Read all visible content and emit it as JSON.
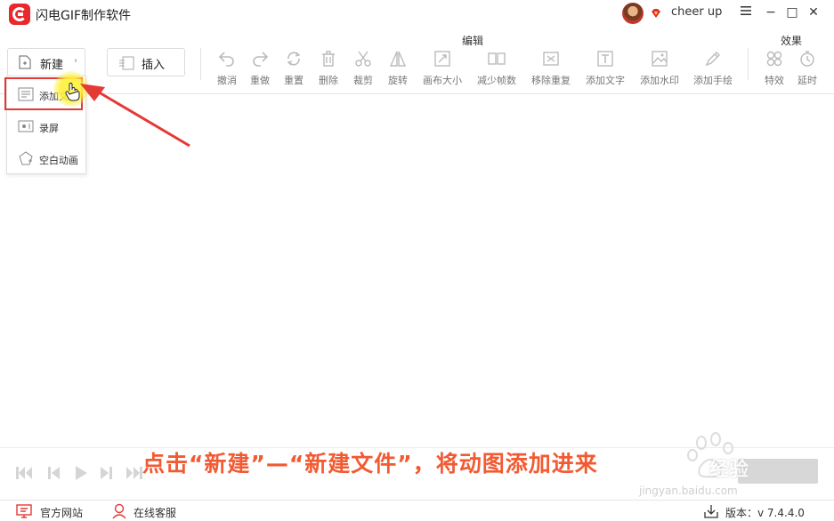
{
  "app": {
    "title": "闪电GIF制作软件",
    "user_name": "cheer up",
    "window_controls": {
      "minimize": "−",
      "maximize": "□",
      "close": "✕"
    },
    "accent": "#e8282d"
  },
  "toolbar": {
    "new_label": "新建",
    "insert_label": "插入",
    "edit_section": "编辑",
    "effects_section": "效果",
    "tools": [
      {
        "label": "撤消",
        "icon": "undo-icon"
      },
      {
        "label": "重做",
        "icon": "redo-icon"
      },
      {
        "label": "重置",
        "icon": "reset-icon"
      },
      {
        "label": "删除",
        "icon": "trash-icon"
      },
      {
        "label": "裁剪",
        "icon": "scissors-icon"
      },
      {
        "label": "旋转",
        "icon": "rotate-icon"
      },
      {
        "label": "画布大小",
        "icon": "canvas-size-icon"
      },
      {
        "label": "减少帧数",
        "icon": "reduce-frames-icon"
      },
      {
        "label": "移除重复",
        "icon": "remove-duplicate-icon"
      },
      {
        "label": "添加文字",
        "icon": "text-icon"
      },
      {
        "label": "添加水印",
        "icon": "watermark-icon"
      },
      {
        "label": "添加手绘",
        "icon": "pen-icon"
      },
      {
        "label": "特效",
        "icon": "effects-icon"
      },
      {
        "label": "延时",
        "icon": "timer-icon"
      }
    ]
  },
  "dropdown": {
    "items": [
      {
        "label": "添加文",
        "icon": "add-file-icon"
      },
      {
        "label": "录屏",
        "icon": "record-screen-icon"
      },
      {
        "label": "空白动画",
        "icon": "blank-animation-icon"
      }
    ]
  },
  "caption": "点击“新建”—“新建文件”，将动图添加进来",
  "watermark": {
    "text": "经验",
    "sub": "jingyan.baidu.com"
  },
  "statusbar": {
    "website": "官方网站",
    "support": "在线客服",
    "version": "版本：v 7.4.4.0"
  },
  "colors": {
    "caption": "#f25a32",
    "highlight": "#e53935"
  }
}
